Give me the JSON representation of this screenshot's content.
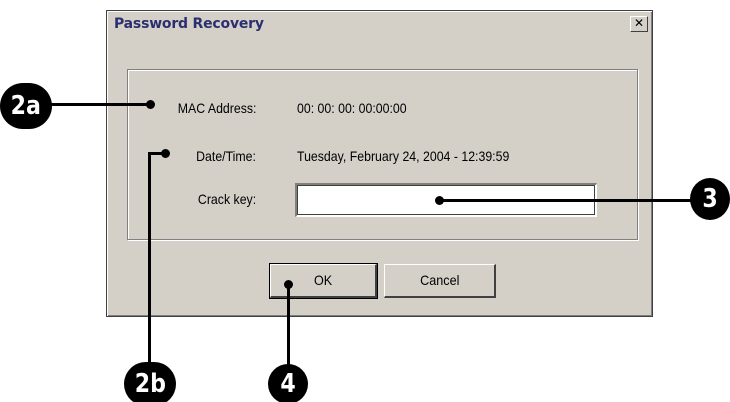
{
  "dialog": {
    "title": "Password Recovery",
    "close_glyph": "✕",
    "fields": {
      "mac_label": "MAC Address:",
      "mac_value": "00: 00: 00: 00:00:00",
      "datetime_label": "Date/Time:",
      "datetime_value": "Tuesday, February 24, 2004 - 12:39:59",
      "crack_key_label": "Crack key:",
      "crack_key_value": ""
    },
    "buttons": {
      "ok_label": "OK",
      "cancel_label": "Cancel"
    }
  },
  "callouts": {
    "c2a": "2a",
    "c2b": "2b",
    "c3": "3",
    "c4": "4"
  },
  "colors": {
    "dialog_bg": "#d4d0c8",
    "title_text": "#2b2f6f",
    "callout_bg": "#000000"
  },
  "icons": {
    "close": "close-icon"
  }
}
